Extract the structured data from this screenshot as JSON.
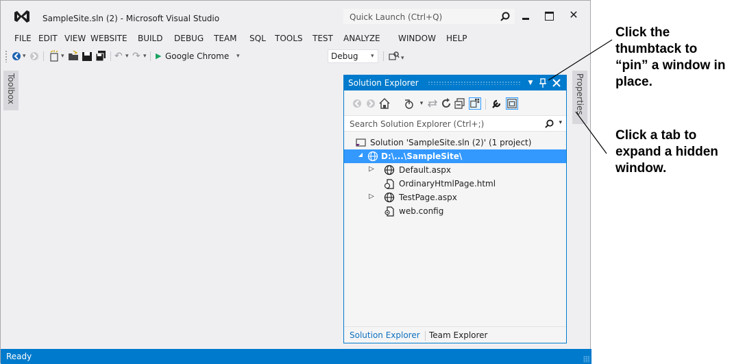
{
  "window": {
    "title": "SampleSite.sln (2) - Microsoft Visual Studio",
    "quick_launch_placeholder": "Quick Launch (Ctrl+Q)",
    "close_glyph": "✕"
  },
  "menu": {
    "items": [
      "FILE",
      "EDIT",
      "VIEW",
      "WEBSITE",
      "BUILD",
      "DEBUG",
      "TEAM",
      "SQL",
      "TOOLS",
      "TEST",
      "ANALYZE",
      "WINDOW",
      "HELP"
    ]
  },
  "toolbar": {
    "run_target": "Google Chrome",
    "configuration": "Debug"
  },
  "side_tabs": {
    "left": "Toolbox",
    "right": "Properties"
  },
  "solution_explorer": {
    "title": "Solution Explorer",
    "search_placeholder": "Search Solution Explorer (Ctrl+;)",
    "tree": [
      {
        "label": "Solution 'SampleSite.sln (2)' (1 project)",
        "icon": "solution-icon"
      },
      {
        "label": "D:\\...\\SampleSite\\",
        "icon": "website-globe-icon",
        "selected": true
      },
      {
        "label": "Default.aspx",
        "icon": "aspx-globe-icon"
      },
      {
        "label": "OrdinaryHtmlPage.html",
        "icon": "html-file-icon"
      },
      {
        "label": "TestPage.aspx",
        "icon": "aspx-globe-icon"
      },
      {
        "label": "web.config",
        "icon": "config-file-icon"
      }
    ],
    "bottom_tabs": [
      "Solution Explorer",
      "Team Explorer"
    ]
  },
  "status": {
    "text": "Ready"
  },
  "annotations": {
    "pin_tip": "Click the thumbtack to “pin” a window in place.",
    "tab_tip": "Click a tab to expand a hidden window."
  },
  "colors": {
    "accent": "#007acc",
    "selection": "#3399ff",
    "chrome": "#efeff2"
  }
}
